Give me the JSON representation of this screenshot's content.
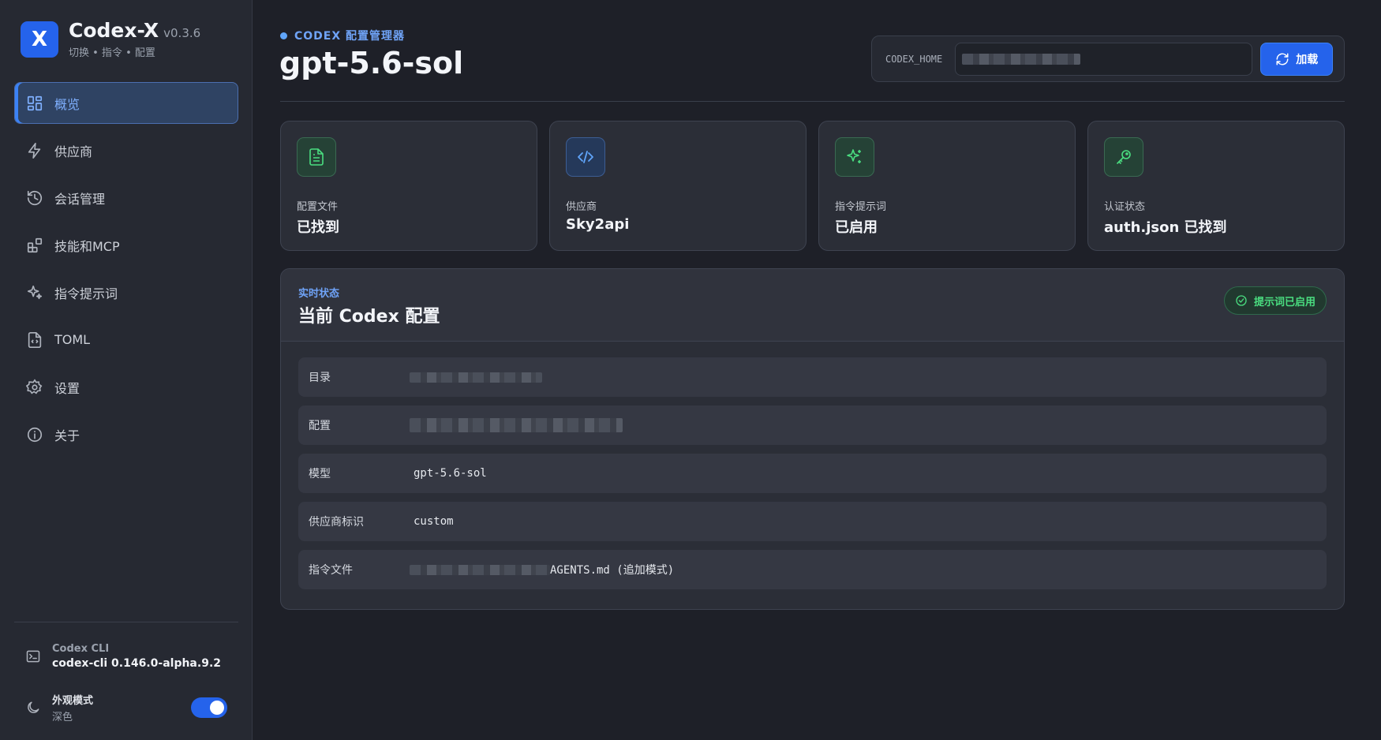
{
  "app": {
    "logo_letter": "X",
    "name": "Codex-X",
    "version": "v0.3.6",
    "tagline": "切换 • 指令 • 配置",
    "accent": "#2563eb"
  },
  "sidebar": {
    "items": [
      {
        "label": "概览",
        "icon": "dashboard-icon",
        "active": true
      },
      {
        "label": "供应商",
        "icon": "lightning-icon"
      },
      {
        "label": "会话管理",
        "icon": "history-icon"
      },
      {
        "label": "技能和MCP",
        "icon": "blocks-icon"
      },
      {
        "label": "指令提示词",
        "icon": "sparkles-icon"
      },
      {
        "label": "TOML",
        "icon": "file-code-icon"
      },
      {
        "label": "设置",
        "icon": "gear-icon"
      },
      {
        "label": "关于",
        "icon": "info-icon"
      }
    ],
    "cli": {
      "label": "Codex CLI",
      "value": "codex-cli 0.146.0-alpha.9.2"
    },
    "theme": {
      "label": "外观模式",
      "value": "深色",
      "enabled": true
    }
  },
  "header": {
    "kicker": "CODEX 配置管理器",
    "title": "gpt-5.6-sol",
    "home_label": "CODEX_HOME",
    "load_label": "加载"
  },
  "cards": [
    {
      "label": "配置文件",
      "value": "已找到",
      "icon": "file-text-icon",
      "tint": "green"
    },
    {
      "label": "供应商",
      "value": "Sky2api",
      "icon": "code-icon",
      "tint": "blue"
    },
    {
      "label": "指令提示词",
      "value": "已启用",
      "icon": "sparkles-icon",
      "tint": "green"
    },
    {
      "label": "认证状态",
      "value": "auth.json 已找到",
      "icon": "key-icon",
      "tint": "green"
    }
  ],
  "panel": {
    "kicker": "实时状态",
    "title": "当前 Codex 配置",
    "badge": "提示词已启用",
    "rows": [
      {
        "key": "目录",
        "value": ""
      },
      {
        "key": "配置",
        "value": ""
      },
      {
        "key": "模型",
        "value": "gpt-5.6-sol"
      },
      {
        "key": "供应商标识",
        "value": "custom"
      },
      {
        "key": "指令文件",
        "value": "AGENTS.md (追加模式)"
      }
    ]
  }
}
